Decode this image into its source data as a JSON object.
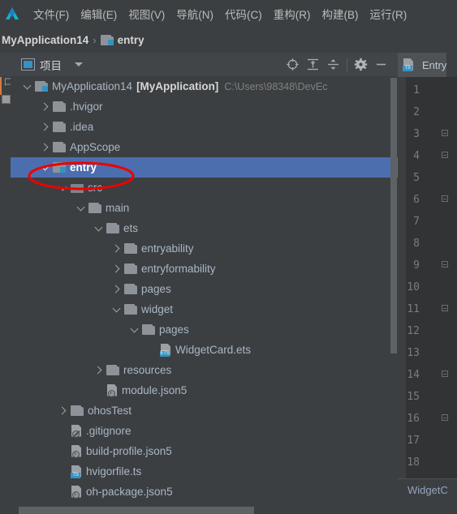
{
  "app": {
    "logo_icon": "deveco-studio-logo",
    "menu": [
      {
        "label": "文件(F)",
        "mnemonic": "F"
      },
      {
        "label": "编辑(E)",
        "mnemonic": "E"
      },
      {
        "label": "视图(V)",
        "mnemonic": "V"
      },
      {
        "label": "导航(N)",
        "mnemonic": "N"
      },
      {
        "label": "代码(C)",
        "mnemonic": "C"
      },
      {
        "label": "重构(R)",
        "mnemonic": "R"
      },
      {
        "label": "构建(B)",
        "mnemonic": "B"
      },
      {
        "label": "运行(R)",
        "mnemonic": "R"
      }
    ]
  },
  "breadcrumb": {
    "project": "MyApplication14",
    "separator": "›",
    "module": "entry",
    "module_icon": "module-folder-icon"
  },
  "tool_window": {
    "title": "项目",
    "title_icon": "project-panel-icon",
    "dropdown_icon": "chevron-down-icon",
    "actions": [
      {
        "name": "select-opened-file-icon",
        "title": "定位"
      },
      {
        "name": "expand-all-icon",
        "title": "全部展开"
      },
      {
        "name": "collapse-all-icon",
        "title": "全部折叠"
      },
      {
        "name": "settings-gear-icon",
        "title": "设置"
      },
      {
        "name": "hide-icon",
        "title": "隐藏"
      }
    ]
  },
  "tree": {
    "rows": [
      {
        "indent": 0,
        "twisty": "expanded",
        "icon": "module-folder-icon",
        "label": "MyApplication14",
        "suffix": "[MyApplication]",
        "path": "C:\\Users\\98348\\DevEc",
        "selected": false,
        "bold_suffix": true
      },
      {
        "indent": 1,
        "twisty": "collapsed",
        "icon": "folder-icon",
        "label": ".hvigor",
        "selected": false
      },
      {
        "indent": 1,
        "twisty": "collapsed",
        "icon": "folder-icon",
        "label": ".idea",
        "selected": false
      },
      {
        "indent": 1,
        "twisty": "collapsed",
        "icon": "folder-icon",
        "label": "AppScope",
        "selected": false
      },
      {
        "indent": 1,
        "twisty": "expanded",
        "icon": "module-folder-icon",
        "label": "entry",
        "selected": true,
        "bold": true
      },
      {
        "indent": 2,
        "twisty": "expanded",
        "icon": "source-folder-icon",
        "label": "src",
        "selected": false
      },
      {
        "indent": 3,
        "twisty": "expanded",
        "icon": "folder-icon",
        "label": "main",
        "selected": false
      },
      {
        "indent": 4,
        "twisty": "expanded",
        "icon": "folder-icon",
        "label": "ets",
        "selected": false
      },
      {
        "indent": 5,
        "twisty": "collapsed",
        "icon": "folder-icon",
        "label": "entryability",
        "selected": false
      },
      {
        "indent": 5,
        "twisty": "collapsed",
        "icon": "folder-icon",
        "label": "entryformability",
        "selected": false
      },
      {
        "indent": 5,
        "twisty": "collapsed",
        "icon": "folder-icon",
        "label": "pages",
        "selected": false
      },
      {
        "indent": 5,
        "twisty": "expanded",
        "icon": "folder-icon",
        "label": "widget",
        "selected": false
      },
      {
        "indent": 6,
        "twisty": "expanded",
        "icon": "folder-icon",
        "label": "pages",
        "selected": false
      },
      {
        "indent": 7,
        "twisty": "none",
        "icon": "ets-file-icon",
        "label": "WidgetCard.ets",
        "selected": false
      },
      {
        "indent": 4,
        "twisty": "collapsed",
        "icon": "folder-icon",
        "label": "resources",
        "selected": false
      },
      {
        "indent": 4,
        "twisty": "none",
        "icon": "json5-file-icon",
        "label": "module.json5",
        "selected": false
      },
      {
        "indent": 2,
        "twisty": "collapsed",
        "icon": "folder-icon",
        "label": "ohosTest",
        "selected": false
      },
      {
        "indent": 2,
        "twisty": "none",
        "icon": "gitignore-file-icon",
        "label": ".gitignore",
        "selected": false
      },
      {
        "indent": 2,
        "twisty": "none",
        "icon": "json5-file-icon",
        "label": "build-profile.json5",
        "selected": false
      },
      {
        "indent": 2,
        "twisty": "none",
        "icon": "ts-file-icon",
        "label": "hvigorfile.ts",
        "selected": false
      },
      {
        "indent": 2,
        "twisty": "none",
        "icon": "json5-file-icon",
        "label": "oh-package.json5",
        "selected": false
      }
    ]
  },
  "editor": {
    "tab": {
      "label": "Entry",
      "icon": "ts-file-icon"
    },
    "line_numbers": [
      "1",
      "2",
      "3",
      "4",
      "5",
      "6",
      "7",
      "8",
      "9",
      "10",
      "11",
      "12",
      "13",
      "14",
      "15",
      "16",
      "17",
      "18"
    ],
    "fold_lines": [
      3,
      4,
      6,
      9,
      11,
      14,
      16
    ],
    "status_breadcrumb": "WidgetC"
  },
  "annotation": {
    "type": "ellipse-highlight",
    "color": "#ee0000",
    "target": "entry"
  },
  "colors": {
    "selection": "#4b6eaf",
    "accent": "#3592c4",
    "panel_bg": "#3c3f41",
    "editor_bg": "#2b2b2b",
    "gutter_bg": "#313335",
    "annotation": "#ee0000"
  }
}
